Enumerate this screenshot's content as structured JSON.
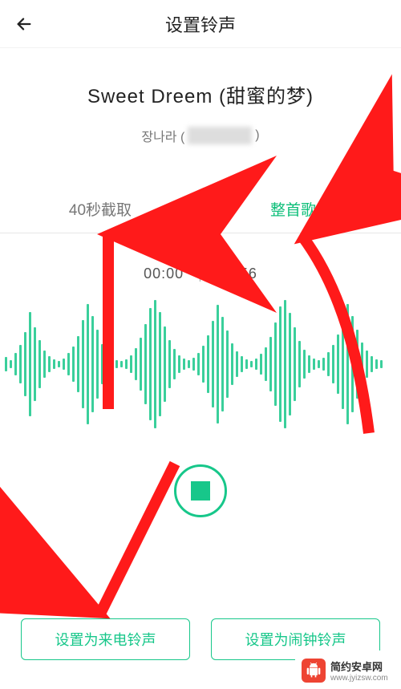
{
  "header": {
    "title": "设置铃声"
  },
  "song": {
    "title": "Sweet Dreem (甜蜜的梦)",
    "artist_prefix": "장나라 ("
  },
  "tabs": {
    "clip": "40秒截取",
    "full": "整首歌曲"
  },
  "timeline": {
    "current": "00:00",
    "total": "03:56"
  },
  "actions": {
    "set_call": "设置为来电铃声",
    "set_alarm": "设置为闹钟铃声"
  },
  "watermark": {
    "line1": "简约安卓网",
    "line2": "www.jyizsw.com"
  },
  "icons": {
    "back": "back-arrow-icon",
    "stop": "stop-icon",
    "android": "android-icon"
  },
  "colors": {
    "accent": "#17c78a",
    "annotation": "#ff1a1a"
  }
}
